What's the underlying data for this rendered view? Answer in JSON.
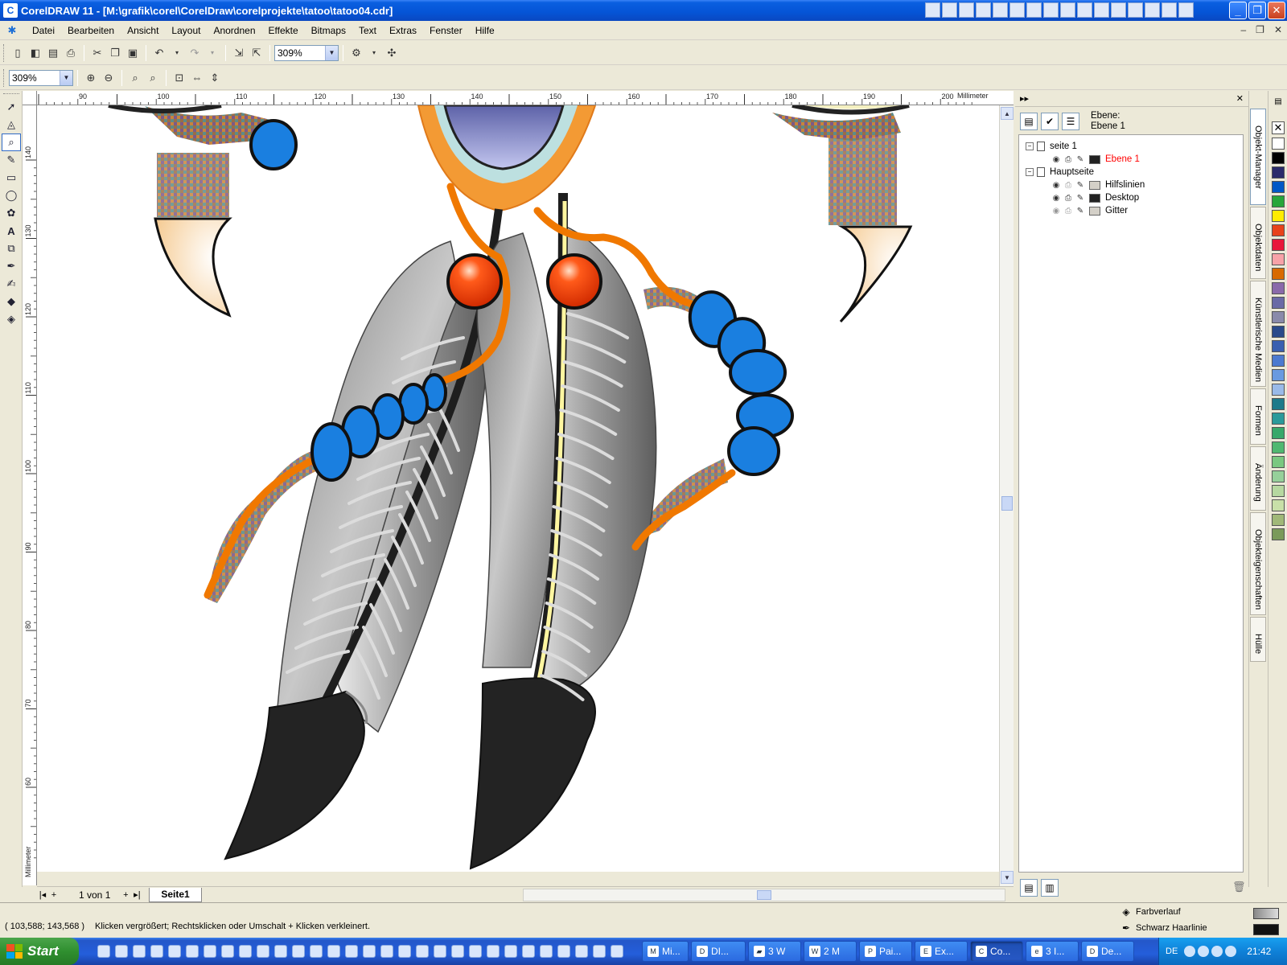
{
  "window": {
    "title": "CorelDRAW 11 - [M:\\grafik\\corel\\CorelDraw\\corelprojekte\\tatoo\\tatoo04.cdr]",
    "minimize": "_",
    "maximize": "❐",
    "close": "✕"
  },
  "menu": [
    "Datei",
    "Bearbeiten",
    "Ansicht",
    "Layout",
    "Anordnen",
    "Effekte",
    "Bitmaps",
    "Text",
    "Extras",
    "Fenster",
    "Hilfe"
  ],
  "toolbar": {
    "zoom_combo": "309%",
    "zoom_combo2": "309%"
  },
  "ruler": {
    "unit_label": "Millimeter",
    "h_ticks": [
      "90",
      "100",
      "110",
      "120",
      "130",
      "140",
      "150",
      "160",
      "170",
      "180",
      "190",
      "200"
    ],
    "v_ticks": [
      "140",
      "130",
      "120",
      "110",
      "100",
      "90",
      "80",
      "70",
      "60"
    ],
    "v_unit_label": "Millimeter"
  },
  "pagebar": {
    "page_count": "1 von 1",
    "page_tab": "Seite1"
  },
  "docker": {
    "layer_heading": "Ebene:",
    "layer_name": "Ebene 1",
    "tree": [
      {
        "label": "seite 1",
        "level": 0,
        "expand": "−"
      },
      {
        "label": "Ebene 1",
        "level": 1,
        "color": "#ff0000",
        "swatch": "#222222"
      },
      {
        "label": "Hauptseite",
        "level": 0,
        "expand": "−"
      },
      {
        "label": "Hilfslinien",
        "level": 1,
        "color": "#000000",
        "swatch": "#d4d0c8"
      },
      {
        "label": "Desktop",
        "level": 1,
        "color": "#000000",
        "swatch": "#222222"
      },
      {
        "label": "Gitter",
        "level": 1,
        "color": "#000000",
        "swatch": "#d4d0c8"
      }
    ],
    "vertical_tabs": [
      "Objekt-Manager",
      "Objektdaten",
      "Künstlerische Medien",
      "Formen",
      "Änderung",
      "Objekteigenschaften",
      "Hülle"
    ]
  },
  "palette": [
    "#ffffff",
    "#000000",
    "#2b2b6b",
    "#0058c6",
    "#27a63a",
    "#ffec00",
    "#e8421a",
    "#e8163a",
    "#f7a2a8",
    "#d86a00",
    "#8a6aaa",
    "#6a6aa6",
    "#8a8aaa",
    "#2a4a8a",
    "#3a5fb0",
    "#4c7ad0",
    "#6a9ae0",
    "#9abae8",
    "#1e7a8a",
    "#2a9a9a",
    "#38a86a",
    "#50b870",
    "#7ac880",
    "#96d09a",
    "#b6d8a0",
    "#c8e0a8",
    "#a0b878",
    "#7a9a5a"
  ],
  "status": {
    "coords": "( 103,588; 143,568 )",
    "message": "Klicken vergrößert; Rechtsklicken oder Umschalt + Klicken verkleinert.",
    "fill_label": "Farbverlauf",
    "outline_label": "Schwarz  Haarlinie"
  },
  "taskbar": {
    "start": "Start",
    "tasks": [
      "Mi...",
      "DI...",
      "3 W",
      "2 M",
      "Pai...",
      "Ex...",
      "Co...",
      "3 I...",
      "De..."
    ],
    "lang": "DE",
    "clock": "21:42"
  }
}
